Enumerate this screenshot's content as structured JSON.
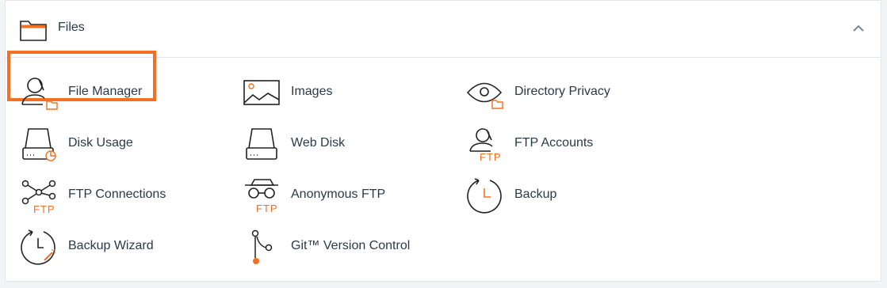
{
  "section": {
    "title": "Files",
    "collapse_icon": "chevron-up-icon"
  },
  "colors": {
    "accent": "#f36f21",
    "text": "#293a4a",
    "border": "#e3e6ea"
  },
  "items": [
    {
      "label": "File Manager",
      "icon": "file-manager-icon"
    },
    {
      "label": "Images",
      "icon": "images-icon"
    },
    {
      "label": "Directory Privacy",
      "icon": "directory-privacy-icon"
    },
    {
      "label": "Disk Usage",
      "icon": "disk-usage-icon"
    },
    {
      "label": "Web Disk",
      "icon": "web-disk-icon"
    },
    {
      "label": "FTP Accounts",
      "icon": "ftp-accounts-icon"
    },
    {
      "label": "FTP Connections",
      "icon": "ftp-connections-icon"
    },
    {
      "label": "Anonymous FTP",
      "icon": "anonymous-ftp-icon"
    },
    {
      "label": "Backup",
      "icon": "backup-icon"
    },
    {
      "label": "Backup Wizard",
      "icon": "backup-wizard-icon"
    },
    {
      "label": "Git™ Version Control",
      "icon": "git-version-control-icon"
    }
  ],
  "ftp_badge": "FTP"
}
